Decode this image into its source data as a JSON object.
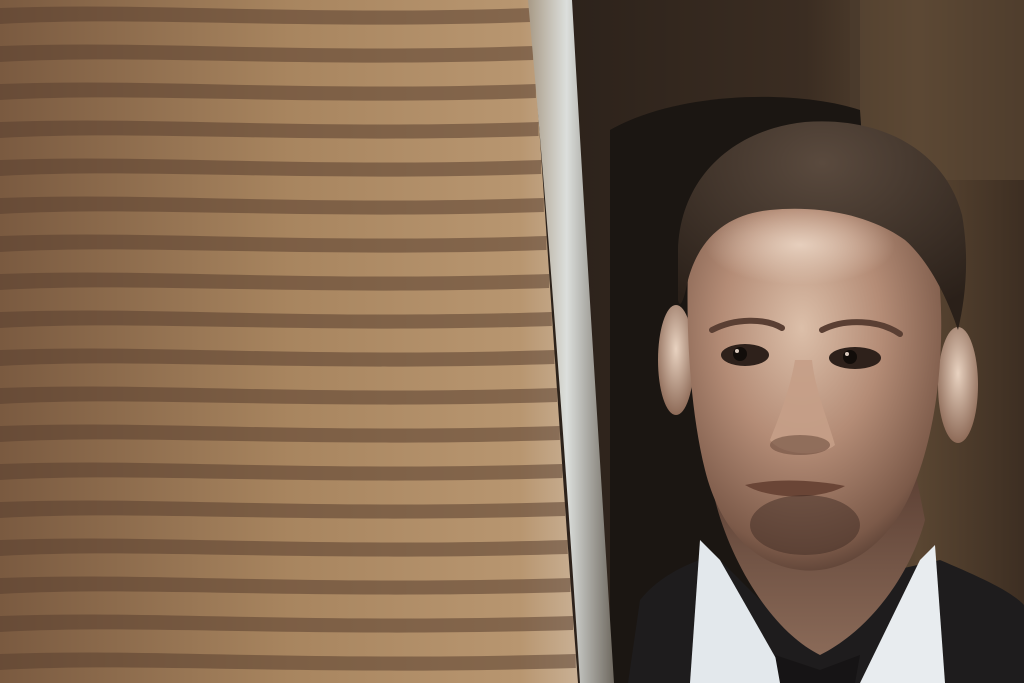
{
  "photo": {
    "palette": {
      "blind_light": "#b3916a",
      "blind_dark": "#5a4030",
      "background": "#2a1f18",
      "wood": "#5a4632",
      "skin_light": "#e8d2c0",
      "skin_mid": "#b48c76",
      "skin_shadow": "#6d4e3f",
      "hair": "#3a2e25",
      "shirt": "#e8ecef",
      "jacket": "#1e1c1d",
      "edge_highlight": "#d9dcd9"
    }
  }
}
